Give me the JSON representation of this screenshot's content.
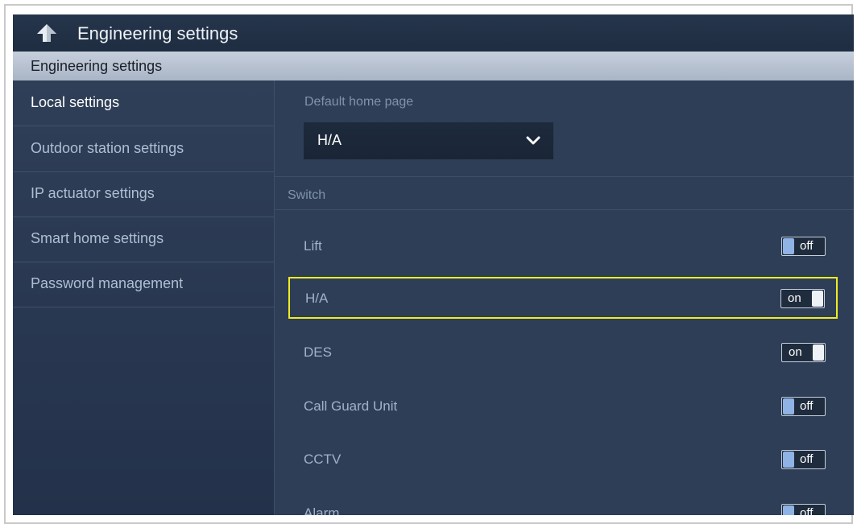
{
  "header": {
    "title": "Engineering settings"
  },
  "section": {
    "title": "Engineering settings"
  },
  "sidebar": {
    "items": [
      {
        "label": "Local settings"
      },
      {
        "label": "Outdoor station settings"
      },
      {
        "label": "IP actuator settings"
      },
      {
        "label": "Smart home settings"
      },
      {
        "label": "Password management"
      }
    ]
  },
  "content": {
    "default_home_page": {
      "label": "Default home page",
      "value": "H/A"
    },
    "switch_header": "Switch",
    "switches": [
      {
        "label": "Lift",
        "state": "off"
      },
      {
        "label": "H/A",
        "state": "on"
      },
      {
        "label": "DES",
        "state": "on"
      },
      {
        "label": "Call Guard Unit",
        "state": "off"
      },
      {
        "label": "CCTV",
        "state": "off"
      },
      {
        "label": "Alarm",
        "state": "off"
      }
    ]
  },
  "colors": {
    "highlight": "#f0ec22",
    "toggle_knob_off": "#8fb3e4",
    "background": "#2b3b52"
  },
  "icons": {
    "back": "up-arrow-icon",
    "dropdown": "chevron-down-icon"
  }
}
